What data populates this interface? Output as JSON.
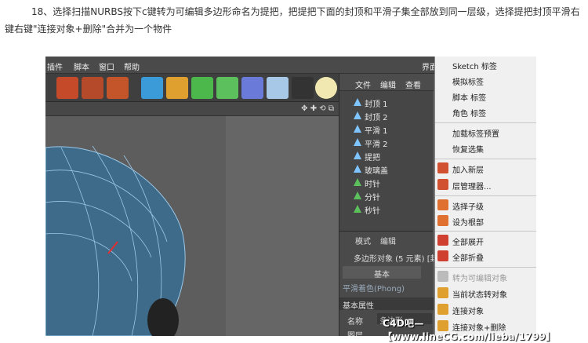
{
  "caption": "18、选择扫描NURBS按下c键转为可编辑多边形命名为提把，把提把下面的封顶和平滑子集全部放到同一层级，选择提把封顶平滑右键右键\"连接对象+删除\"合并为一个物件",
  "menu": [
    "插件",
    "脚本",
    "窗口",
    "帮助"
  ],
  "menu_right": "界面",
  "object_manager": {
    "tabs": [
      "文件",
      "编辑",
      "查看"
    ],
    "rows": [
      "封顶 1",
      "封顶 2",
      "平滑 1",
      "平滑 2",
      "提把",
      "玻璃盖",
      "时针",
      "分针",
      "秒针"
    ]
  },
  "attributes": {
    "tabs": [
      "模式",
      "编辑"
    ],
    "object": "多边形对象 (5 元素) [封",
    "tab_basic": "基本",
    "phong": "平滑着色(Phong)",
    "section": "基本属性",
    "name_label": "名称",
    "layer_label": "图层",
    "name_value": "多边形"
  },
  "context_menu": [
    "Sketch 标签",
    "模拟标签",
    "脚本 标签",
    "角色 标签",
    "加载标签预置",
    "恢复选集",
    "加入新层",
    "层管理器...",
    "选择子级",
    "设为根部",
    "全部展开",
    "全部折叠",
    "转为可编辑对象",
    "当前状态转对象",
    "连接对象",
    "连接对象+删除"
  ],
  "watermark": "C4D吧—【www.lineCG.com/lieba/1799】",
  "colors": {
    "accent": "#7fc4ff",
    "panel": "#464646",
    "menu_bg": "#f0f0f0"
  }
}
